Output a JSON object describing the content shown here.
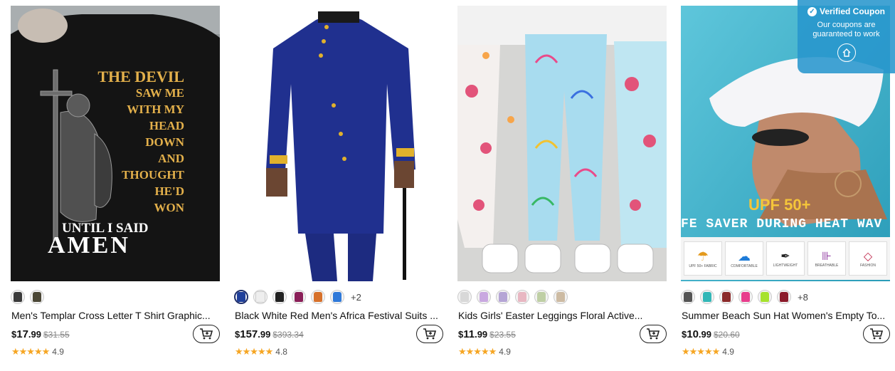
{
  "products": [
    {
      "title": "Men's Templar Cross Letter T Shirt Graphic...",
      "price_prefix": "$",
      "price_main": "17",
      "price_cents": ".99",
      "original_price": "$31.55",
      "rating": "4.9",
      "swatches": [
        "#3a3a3a",
        "#4b4736"
      ],
      "more": "",
      "image_text": [
        "THE DEVIL",
        "SAW ME",
        "WITH MY",
        "HEAD",
        "DOWN",
        "AND",
        "THOUGHT",
        "HE'D",
        "WON"
      ],
      "image_text2": "UNTIL I SAID",
      "image_text3": "AMEN"
    },
    {
      "title": "Black White Red Men's Africa Festival Suits ...",
      "price_prefix": "$",
      "price_main": "157",
      "price_cents": ".99",
      "original_price": "$393.34",
      "rating": "4.8",
      "swatches": [
        "#1f3f9b",
        "#eeeeee",
        "#222222",
        "#8a1f58",
        "#d7712b",
        "#2f79d9"
      ],
      "more": "+2"
    },
    {
      "title": "Kids Girls' Easter Leggings Floral Active...",
      "price_prefix": "$",
      "price_main": "11",
      "price_cents": ".99",
      "original_price": "$23.55",
      "rating": "4.9",
      "swatches": [
        "#d8d8d8",
        "#c9a8e0",
        "#b5a5d5",
        "#e8b7c2",
        "#bfcfa5",
        "#cdbba3"
      ],
      "more": ""
    },
    {
      "title": "Summer Beach Sun Hat Women's Empty To...",
      "price_prefix": "$",
      "price_main": "10",
      "price_cents": ".99",
      "original_price": "$20.60",
      "rating": "4.9",
      "swatches": [
        "#555555",
        "#32b7b7",
        "#8b2a2a",
        "#e83d8c",
        "#a6e22e",
        "#8b1a2a"
      ],
      "more": "+8",
      "image_text": "UPF 50+",
      "image_text2": "FE SAVER DURING HEAT WAV",
      "badges": [
        "UPF 50+ FABRIC",
        "COMFORTABLE",
        "LIGHTWEIGHT",
        "BREATHABLE",
        "FASHION"
      ]
    }
  ],
  "coupon": {
    "title": "Verified Coupon",
    "message": "Our coupons are guaranteed to work"
  },
  "stars": "★★★★★",
  "colors": {
    "accent": "#f6a623",
    "coupon_bg": "#2896cd"
  }
}
